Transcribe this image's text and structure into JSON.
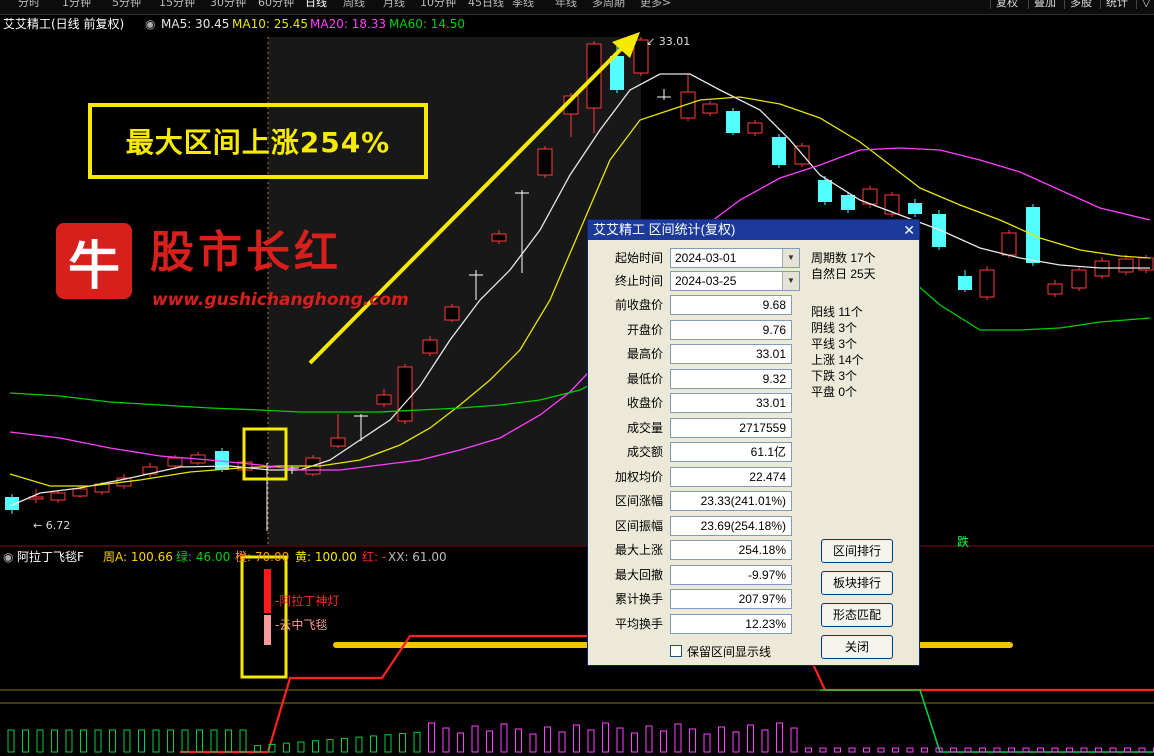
{
  "topbar": {
    "periods": [
      "分时",
      "1分钟",
      "5分钟",
      "15分钟",
      "30分钟",
      "60分钟",
      "日线",
      "周线",
      "月线",
      "10分钟",
      "45日线",
      "季线",
      "年线",
      "多周期",
      "更多>"
    ],
    "active_period": "日线",
    "right_buttons": [
      "复权",
      "叠加",
      "多股",
      "统计",
      "▽"
    ]
  },
  "title": {
    "stock": "艾艾精工(日线 前复权)",
    "ma5": "MA5: 30.45",
    "ma10": "MA10: 25.45",
    "ma20": "MA20: 18.33",
    "ma60": "MA60: 14.50"
  },
  "colors": {
    "up": "#ff3b3b",
    "down": "#54ffff",
    "ma5": "#e8e8e8",
    "ma10": "#e6e600",
    "ma20": "#ff40ff",
    "ma60": "#00d000",
    "highlight": "#f5ea00"
  },
  "banner": "最大区间上涨254%",
  "logo": {
    "icon": "牛",
    "name": "股市长红",
    "url": "www.gushichanghong.com"
  },
  "price_labels": {
    "high": "33.01",
    "low": "6.72"
  },
  "marker_die": "跌",
  "indicator": {
    "name": "阿拉丁飞毯F",
    "zhou_a": "周A: 100.66",
    "lv": "绿: 46.00",
    "cheng": "橙: 70.00",
    "huang": "黄: 100.00",
    "hong": "红: -",
    "xx": "XX: 61.00",
    "legend_red": "阿拉丁神灯",
    "legend_pink": "云中飞毯"
  },
  "dialog": {
    "title": "艾艾精工 区间统计(复权)",
    "start_label": "起始时间",
    "start_value": "2024-03-01",
    "end_label": "终止时间",
    "end_value": "2024-03-25",
    "fields": [
      {
        "label": "前收盘价",
        "value": "9.68"
      },
      {
        "label": "开盘价",
        "value": "9.76"
      },
      {
        "label": "最高价",
        "value": "33.01"
      },
      {
        "label": "最低价",
        "value": "9.32"
      },
      {
        "label": "收盘价",
        "value": "33.01"
      },
      {
        "label": "成交量",
        "value": "2717559"
      },
      {
        "label": "成交额",
        "value": "61.1亿"
      },
      {
        "label": "加权均价",
        "value": "22.474"
      },
      {
        "label": "区间涨幅",
        "value": "23.33(241.01%)"
      },
      {
        "label": "区间振幅",
        "value": "23.69(254.18%)"
      },
      {
        "label": "最大上涨",
        "value": "254.18%"
      },
      {
        "label": "最大回撤",
        "value": "-9.97%"
      },
      {
        "label": "累计换手",
        "value": "207.97%"
      },
      {
        "label": "平均换手",
        "value": "12.23%"
      }
    ],
    "stats_top": [
      "周期数 17个",
      "自然日 25天"
    ],
    "stats": [
      "阳线 11个",
      "阴线 3个",
      "平线 3个",
      "上涨 14个",
      "下跌 3个",
      "平盘 0个"
    ],
    "buttons": [
      "区间排行",
      "板块排行",
      "形态匹配",
      "关闭"
    ],
    "checkbox_label": "保留区间显示线"
  }
}
